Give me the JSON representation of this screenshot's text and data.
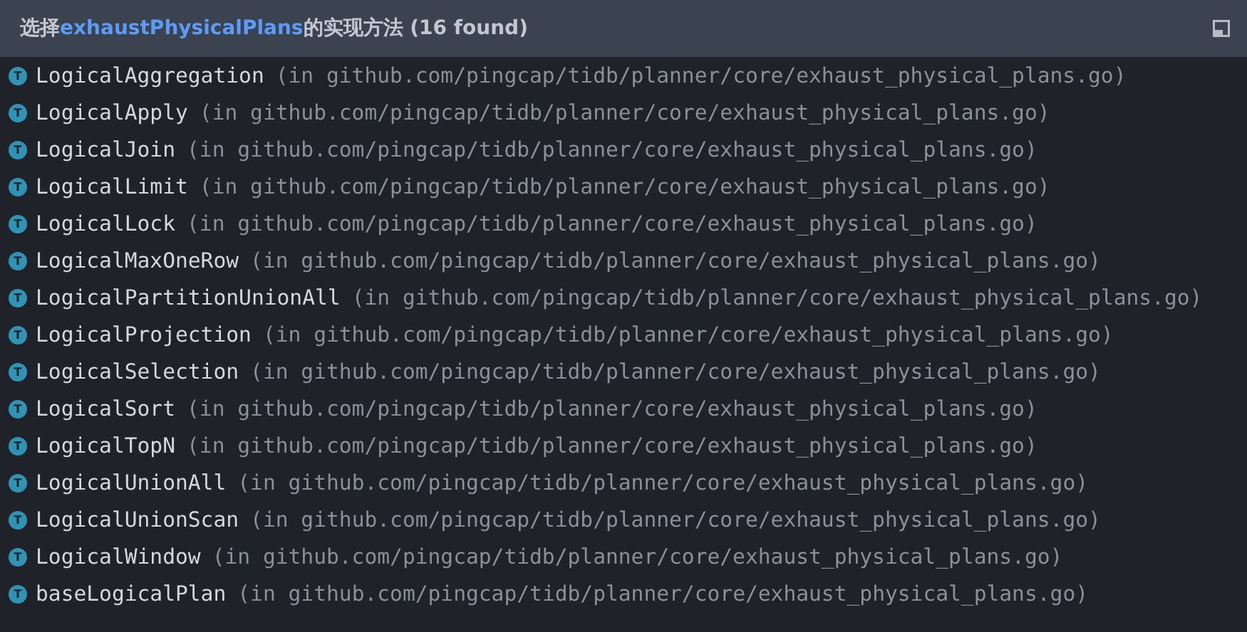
{
  "header": {
    "title_prefix": "选择",
    "title_method": "exhaustPhysicalPlans",
    "title_suffix": "的实现方法 (16 found)"
  },
  "items": [
    {
      "badge": "T",
      "name": "LogicalAggregation",
      "location": "(in github.com/pingcap/tidb/planner/core/exhaust_physical_plans.go)",
      "selected": false
    },
    {
      "badge": "T",
      "name": "LogicalApply",
      "location": "(in github.com/pingcap/tidb/planner/core/exhaust_physical_plans.go)",
      "selected": false
    },
    {
      "badge": "T",
      "name": "LogicalJoin",
      "location": "(in github.com/pingcap/tidb/planner/core/exhaust_physical_plans.go)",
      "selected": false
    },
    {
      "badge": "T",
      "name": "LogicalLimit",
      "location": "(in github.com/pingcap/tidb/planner/core/exhaust_physical_plans.go)",
      "selected": false
    },
    {
      "badge": "T",
      "name": "LogicalLock",
      "location": "(in github.com/pingcap/tidb/planner/core/exhaust_physical_plans.go)",
      "selected": false
    },
    {
      "badge": "T",
      "name": "LogicalMaxOneRow",
      "location": "(in github.com/pingcap/tidb/planner/core/exhaust_physical_plans.go)",
      "selected": false
    },
    {
      "badge": "T",
      "name": "LogicalPartitionUnionAll",
      "location": "(in github.com/pingcap/tidb/planner/core/exhaust_physical_plans.go)",
      "selected": false
    },
    {
      "badge": "T",
      "name": "LogicalProjection",
      "location": "(in github.com/pingcap/tidb/planner/core/exhaust_physical_plans.go)",
      "selected": false
    },
    {
      "badge": "T",
      "name": "LogicalSelection",
      "location": "(in github.com/pingcap/tidb/planner/core/exhaust_physical_plans.go)",
      "selected": false
    },
    {
      "badge": "T",
      "name": "LogicalSort",
      "location": "(in github.com/pingcap/tidb/planner/core/exhaust_physical_plans.go)",
      "selected": false
    },
    {
      "badge": "T",
      "name": "LogicalTopN",
      "location": "(in github.com/pingcap/tidb/planner/core/exhaust_physical_plans.go)",
      "selected": false
    },
    {
      "badge": "T",
      "name": "LogicalUnionAll",
      "location": "(in github.com/pingcap/tidb/planner/core/exhaust_physical_plans.go)",
      "selected": false
    },
    {
      "badge": "T",
      "name": "LogicalUnionScan",
      "location": "(in github.com/pingcap/tidb/planner/core/exhaust_physical_plans.go)",
      "selected": false
    },
    {
      "badge": "T",
      "name": "LogicalWindow",
      "location": "(in github.com/pingcap/tidb/planner/core/exhaust_physical_plans.go)",
      "selected": false
    },
    {
      "badge": "T",
      "name": "baseLogicalPlan",
      "location": "(in github.com/pingcap/tidb/planner/core/exhaust_physical_plans.go)",
      "selected": false
    }
  ]
}
